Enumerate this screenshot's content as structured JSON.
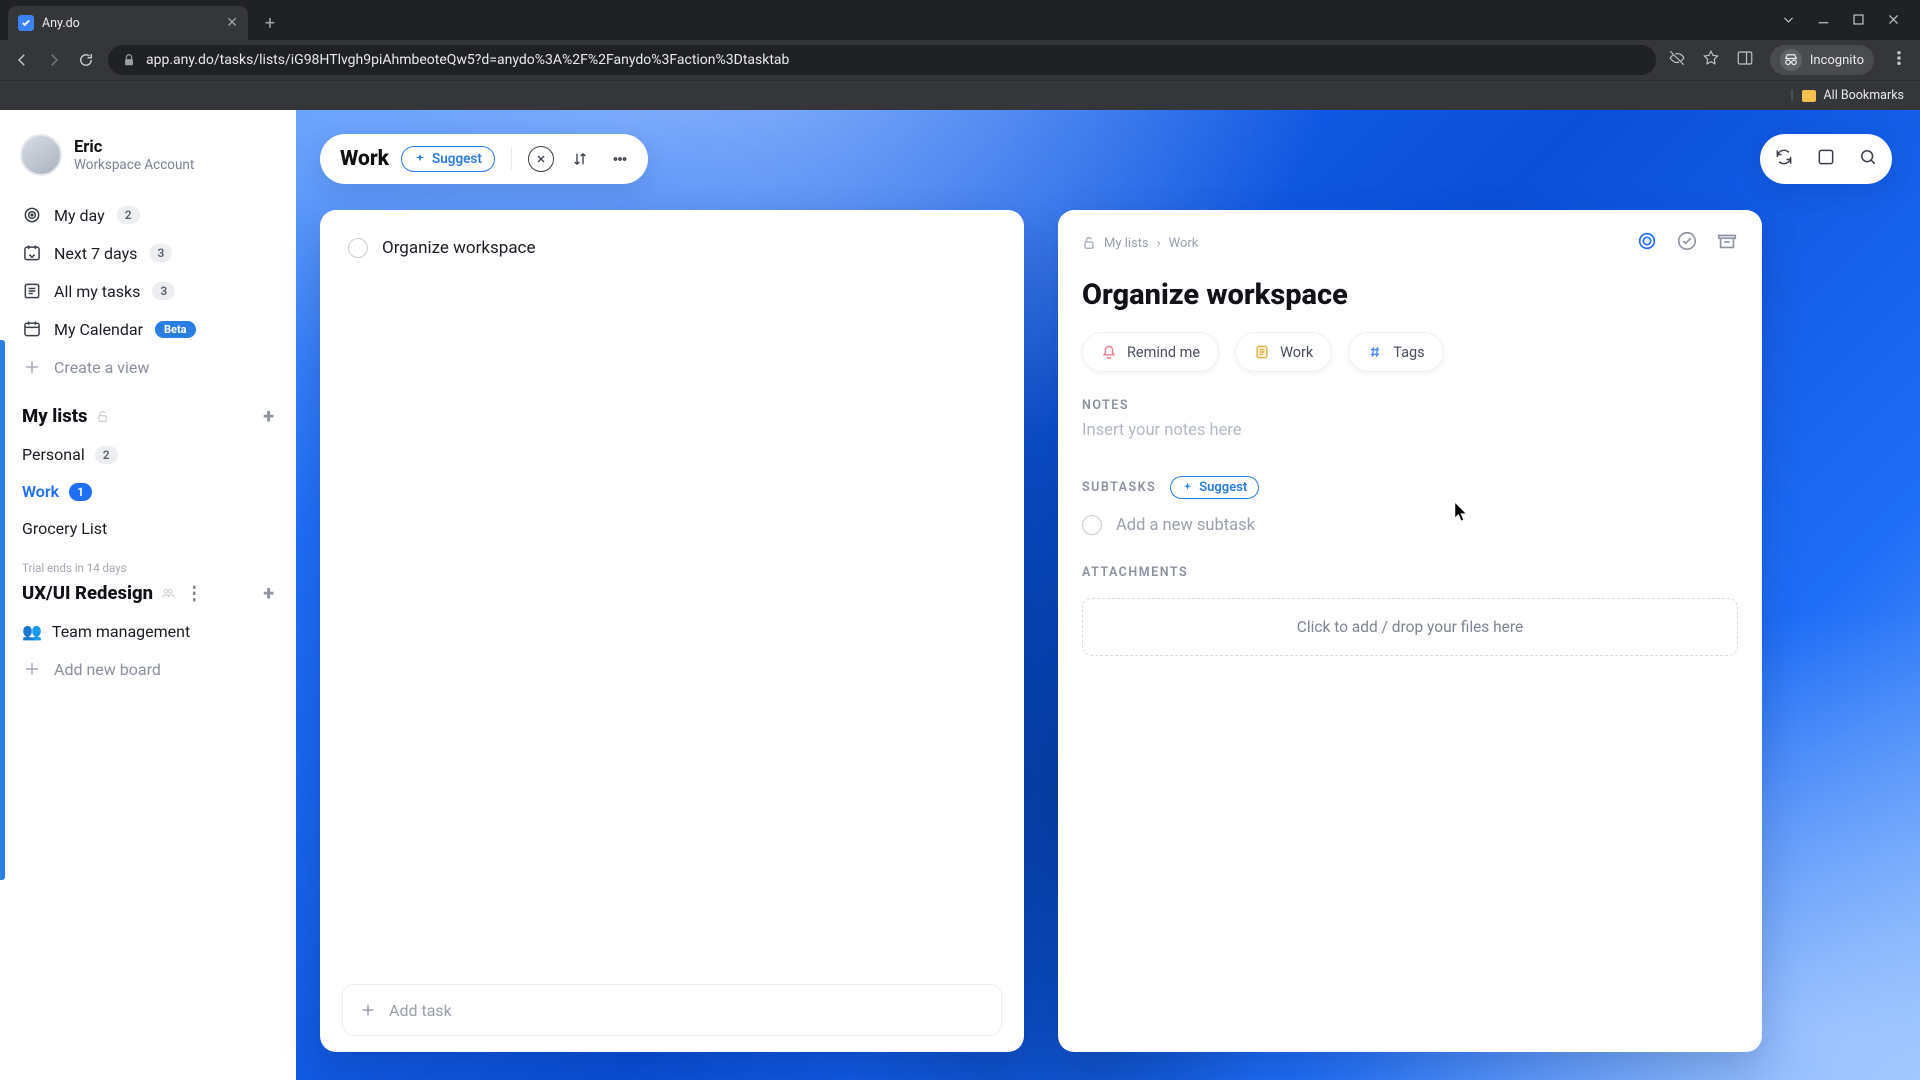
{
  "browser": {
    "tab_title": "Any.do",
    "url": "app.any.do/tasks/lists/iG98HTlvgh9piAhmbeoteQw5?d=anydo%3A%2F%2Fanydo%3Faction%3Dtasktab",
    "incognito_label": "Incognito",
    "bookmarks_label": "All Bookmarks"
  },
  "profile": {
    "name": "Eric",
    "subtitle": "Workspace Account"
  },
  "nav": {
    "myday": "My day",
    "myday_count": "2",
    "next7": "Next 7 days",
    "next7_count": "3",
    "alltasks": "All my tasks",
    "alltasks_count": "3",
    "calendar": "My Calendar",
    "calendar_badge": "Beta",
    "create_view": "Create a view"
  },
  "lists": {
    "heading": "My lists",
    "items": [
      {
        "label": "Personal",
        "count": "2"
      },
      {
        "label": "Work",
        "count": "1",
        "active": true
      },
      {
        "label": "Grocery List"
      }
    ]
  },
  "workspace": {
    "trial_note": "Trial ends in 14 days",
    "name": "UX/UI Redesign",
    "board": "Team management",
    "add_board": "Add new board"
  },
  "header": {
    "title": "Work",
    "suggest": "Suggest"
  },
  "tasks": {
    "items": [
      {
        "title": "Organize workspace"
      }
    ],
    "add_placeholder": "Add task"
  },
  "detail": {
    "breadcrumb_root": "My lists",
    "breadcrumb_leaf": "Work",
    "title": "Organize workspace",
    "chip_remind": "Remind me",
    "chip_list": "Work",
    "chip_tags": "Tags",
    "notes_label": "NOTES",
    "notes_placeholder": "Insert your notes here",
    "subtasks_label": "SUBTASKS",
    "subtasks_suggest": "Suggest",
    "subtask_placeholder": "Add a new subtask",
    "attachments_label": "ATTACHMENTS",
    "attachments_placeholder": "Click to add / drop your files here"
  }
}
